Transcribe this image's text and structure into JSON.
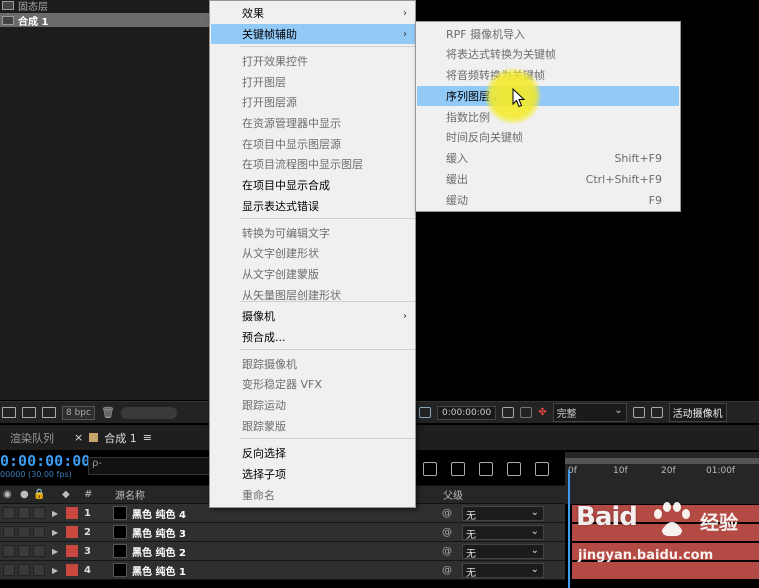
{
  "project": {
    "rows": [
      "固态层",
      "合成 1"
    ]
  },
  "project_toolbar": {
    "bpc": "8 bpc"
  },
  "viewer_toolbar": {
    "time": "0:00:00:00",
    "quality": "完整",
    "active_camera": "活动摄像机"
  },
  "tabs": {
    "render_queue": "渲染队列",
    "comp": "合成 1",
    "comp_close": "×",
    "comp_menu": "≡"
  },
  "timeline": {
    "timecode": "0:00:00:00",
    "fps": "00000 (30.00 fps)",
    "search_placeholder": "ρ-",
    "header": {
      "hash": "#",
      "source_name": "源名称",
      "parent": "父级"
    },
    "ruler": [
      "0f",
      "10f",
      "20f",
      "01:00f"
    ],
    "layers": [
      {
        "num": "1",
        "name": "黑色 纯色 4",
        "parent": "无"
      },
      {
        "num": "2",
        "name": "黑色 纯色 3",
        "parent": "无"
      },
      {
        "num": "3",
        "name": "黑色 纯色 2",
        "parent": "无"
      },
      {
        "num": "4",
        "name": "黑色 纯色 1",
        "parent": "无"
      }
    ]
  },
  "context_menu": {
    "items": [
      {
        "label": "效果",
        "disabled": false,
        "submenu": true
      },
      {
        "label": "关键帧辅助",
        "disabled": false,
        "submenu": true,
        "active": true
      },
      {
        "label": "打开效果控件",
        "disabled": true
      },
      {
        "label": "打开图层",
        "disabled": true
      },
      {
        "label": "打开图层源",
        "disabled": true
      },
      {
        "label": "在资源管理器中显示",
        "disabled": true
      },
      {
        "label": "在项目中显示图层源",
        "disabled": true
      },
      {
        "label": "在项目流程图中显示图层",
        "disabled": true
      },
      {
        "label": "在项目中显示合成",
        "disabled": false
      },
      {
        "label": "显示表达式错误",
        "disabled": false
      },
      {
        "label": "转换为可编辑文字",
        "disabled": true
      },
      {
        "label": "从文字创建形状",
        "disabled": true
      },
      {
        "label": "从文字创建蒙版",
        "disabled": true
      },
      {
        "label": "从矢量图层创建形状",
        "disabled": true
      },
      {
        "label": "摄像机",
        "disabled": false,
        "submenu": true
      },
      {
        "label": "预合成...",
        "disabled": false
      },
      {
        "label": "跟踪摄像机",
        "disabled": true
      },
      {
        "label": "变形稳定器 VFX",
        "disabled": true
      },
      {
        "label": "跟踪运动",
        "disabled": true
      },
      {
        "label": "跟踪蒙版",
        "disabled": true
      },
      {
        "label": "反向选择",
        "disabled": false
      },
      {
        "label": "选择子项",
        "disabled": false
      },
      {
        "label": "重命名",
        "disabled": true
      }
    ],
    "submenu_arrow": "›"
  },
  "keyframe_submenu": {
    "items": [
      {
        "label": "RPF 摄像机导入",
        "shortcut": ""
      },
      {
        "label": "将表达式转换为关键帧",
        "shortcut": ""
      },
      {
        "label": "将音频转换为关键帧",
        "shortcut": ""
      },
      {
        "label": "序列图层...",
        "shortcut": "",
        "active": true
      },
      {
        "label": "指数比例",
        "shortcut": ""
      },
      {
        "label": "时间反向关键帧",
        "shortcut": ""
      },
      {
        "label": "缓入",
        "shortcut": "Shift+F9"
      },
      {
        "label": "缓出",
        "shortcut": "Ctrl+Shift+F9"
      },
      {
        "label": "缓动",
        "shortcut": "F9"
      }
    ]
  },
  "watermark": {
    "logo": "Baid",
    "text": "经验",
    "url": "jingyan.baidu.com"
  },
  "colors": {
    "menu_bg": "#f0f0f0",
    "menu_highlight": "#91c9f7",
    "timecode_blue": "#3d9df3",
    "layer_label_red": "#c94840",
    "cursor_highlight": "#f5eb28"
  }
}
